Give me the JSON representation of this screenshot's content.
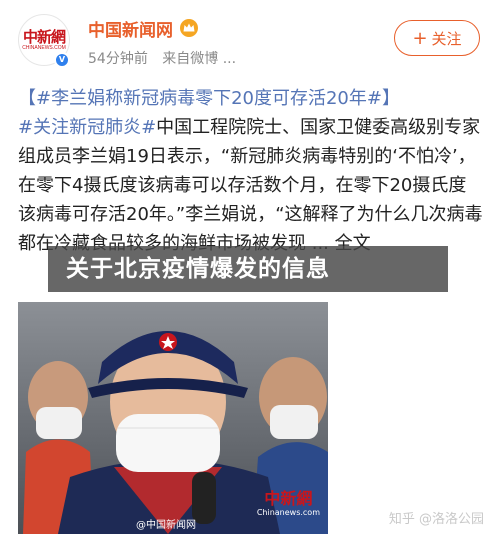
{
  "account": {
    "name": "中国新闻网",
    "avatar_text_cn": "中新網",
    "avatar_text_en": "CHINANEWS.COM",
    "verified": true,
    "time": "54分钟前",
    "source": "来自微博 ..."
  },
  "follow_button": {
    "label": "关注",
    "icon": "plus-icon"
  },
  "post": {
    "line1": "【#李兰娟称新冠病毒零下20度可存活20年#】",
    "tag2": "#关注新冠肺炎#",
    "body": "中国工程院院士、国家卫健委高级别专家组成员李兰娟19日表示，“新冠肺炎病毒特别的‘不怕冷’，在零下4摄氏度该病毒可以存活数个月，在零下20摄氏度该病毒可存活20年。”李兰娟说，“这解释了为什么几次病毒都在冷藏食品较多的海鲜市场被发现 ... 全文"
  },
  "banner": {
    "text": "关于北京疫情爆发的信息"
  },
  "photo": {
    "watermark_weibo": "@中国新闻网",
    "watermark_logo_cn": "中新網",
    "watermark_logo_en": "Chinanews.com"
  },
  "watermark": {
    "text": "知乎 @洛洛公园"
  },
  "colors": {
    "brand": "#e8602c",
    "topic": "#5575b6",
    "logo_red": "#c8161d"
  }
}
